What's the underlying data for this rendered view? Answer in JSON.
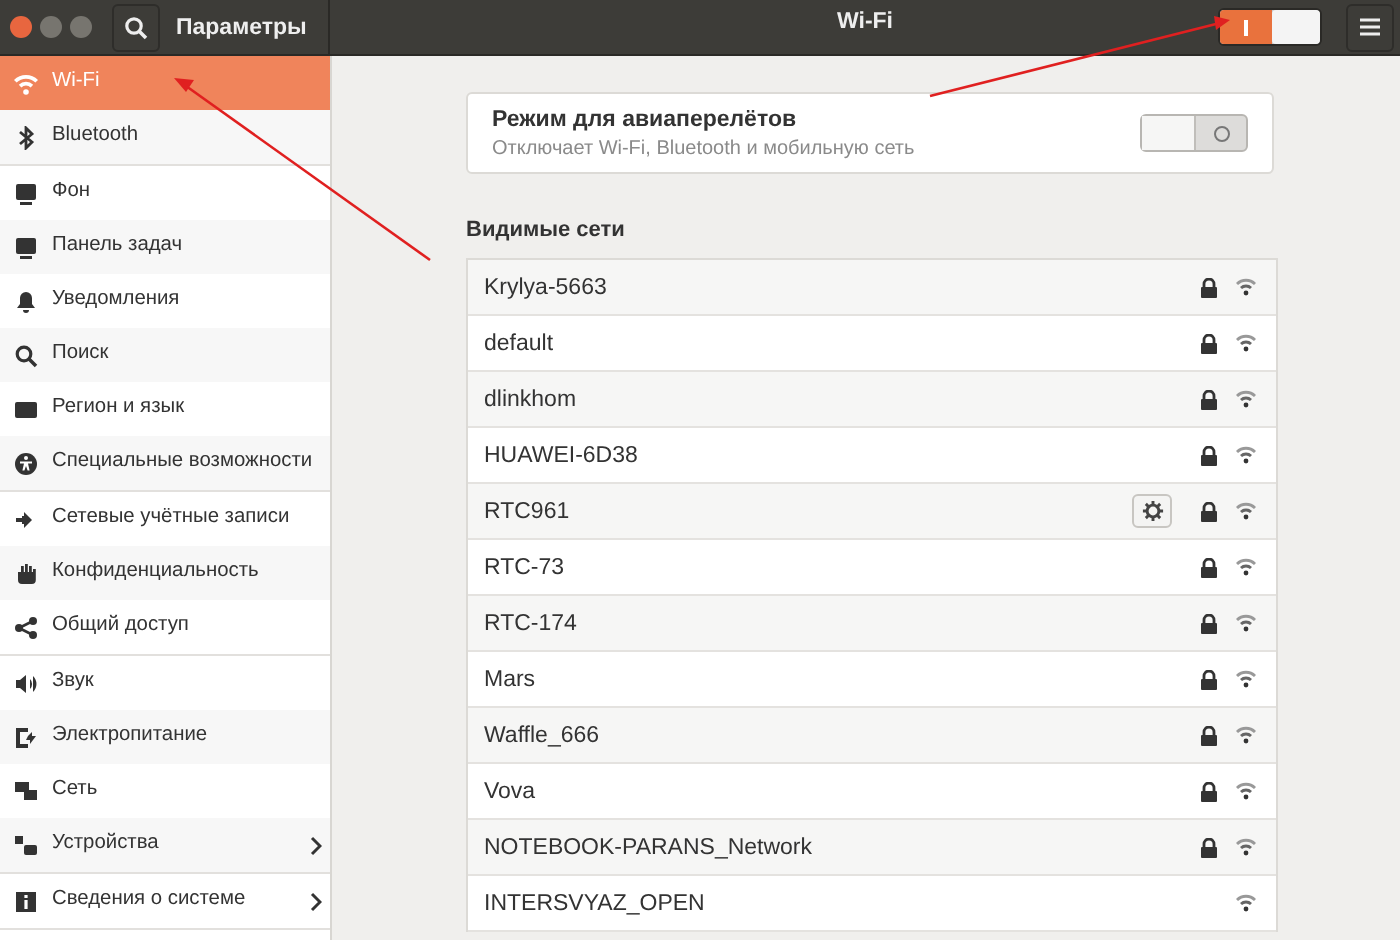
{
  "window": {
    "app_title": "Параметры",
    "page_title": "Wi-Fi",
    "wifi_switch": {
      "on": true
    }
  },
  "sidebar": {
    "groups": [
      [
        {
          "label": "Wi-Fi",
          "selected": true,
          "submenu": false
        },
        {
          "label": "Bluetooth",
          "selected": false,
          "submenu": false
        }
      ],
      [
        {
          "label": "Фон",
          "selected": false,
          "submenu": false
        },
        {
          "label": "Панель задач",
          "selected": false,
          "submenu": false
        },
        {
          "label": "Уведомления",
          "selected": false,
          "submenu": false
        },
        {
          "label": "Поиск",
          "selected": false,
          "submenu": false
        },
        {
          "label": "Регион и язык",
          "selected": false,
          "submenu": false
        },
        {
          "label": "Специальные возможности",
          "selected": false,
          "submenu": false
        }
      ],
      [
        {
          "label": "Сетевые учётные записи",
          "selected": false,
          "submenu": false
        },
        {
          "label": "Конфиденциальность",
          "selected": false,
          "submenu": false
        },
        {
          "label": "Общий доступ",
          "selected": false,
          "submenu": false
        }
      ],
      [
        {
          "label": "Звук",
          "selected": false,
          "submenu": false
        },
        {
          "label": "Электропитание",
          "selected": false,
          "submenu": false
        },
        {
          "label": "Сеть",
          "selected": false,
          "submenu": false
        },
        {
          "label": "Устройства",
          "selected": false,
          "submenu": true
        }
      ],
      [
        {
          "label": "Сведения о системе",
          "selected": false,
          "submenu": true
        }
      ]
    ]
  },
  "airplane_mode": {
    "title": "Режим для авиаперелётов",
    "description": "Отключает Wi-Fi, Bluetooth и мобильную сеть",
    "on": false
  },
  "networks": {
    "heading": "Видимые сети",
    "items": [
      {
        "name": "Krylya-5663",
        "secured": true,
        "settings": false
      },
      {
        "name": "default",
        "secured": true,
        "settings": false
      },
      {
        "name": "dlinkhom",
        "secured": true,
        "settings": false
      },
      {
        "name": "HUAWEI-6D38",
        "secured": true,
        "settings": false
      },
      {
        "name": "RTC961",
        "secured": true,
        "settings": true
      },
      {
        "name": "RTC-73",
        "secured": true,
        "settings": false
      },
      {
        "name": "RTC-174",
        "secured": true,
        "settings": false
      },
      {
        "name": "Mars",
        "secured": true,
        "settings": false
      },
      {
        "name": "Waffle_666",
        "secured": true,
        "settings": false
      },
      {
        "name": "Vova",
        "secured": true,
        "settings": false
      },
      {
        "name": "NOTEBOOK-PARANS_Network",
        "secured": true,
        "settings": false
      },
      {
        "name": "INTERSVYAZ_OPEN",
        "secured": false,
        "settings": false
      }
    ]
  }
}
